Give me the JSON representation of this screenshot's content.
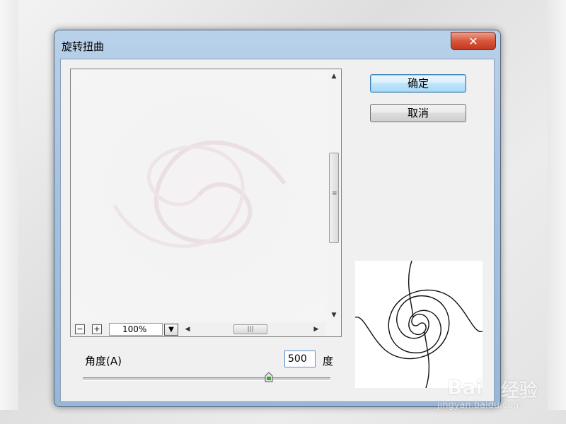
{
  "window": {
    "title": "旋转扭曲",
    "close_label": "✕"
  },
  "buttons": {
    "ok_label": "确定",
    "cancel_label": "取消"
  },
  "preview": {
    "zoom_out_label": "−",
    "zoom_in_label": "+",
    "zoom_value": "100%",
    "dropdown_icon": "▼",
    "scroll_up": "▲",
    "scroll_down": "▼",
    "scroll_left": "◀",
    "scroll_right": "▶",
    "grip": "≡",
    "hgrip": "|||"
  },
  "angle": {
    "label": "角度(A)",
    "value": "500",
    "unit": "度",
    "slider_fraction": 0.75
  },
  "watermark": {
    "brand": "Bai",
    "brand_cn": "经验",
    "url": "jingyan.baidu.com"
  },
  "colors": {
    "ok_border": "#3c7fb1",
    "close_red": "#c2381e"
  }
}
